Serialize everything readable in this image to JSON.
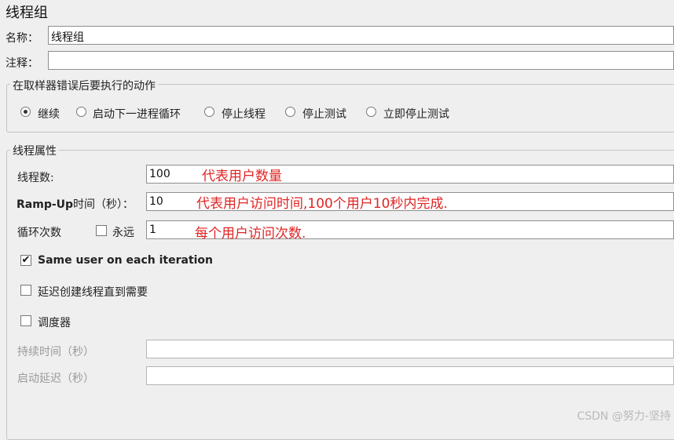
{
  "header": {
    "title": "线程组"
  },
  "name_field": {
    "label": "名称：",
    "value": "线程组"
  },
  "comment_field": {
    "label": "注释：",
    "value": ""
  },
  "error_action": {
    "legend": "在取样器错误后要执行的动作",
    "options": [
      {
        "label": "继续",
        "selected": true
      },
      {
        "label": "启动下一进程循环",
        "selected": false
      },
      {
        "label": "停止线程",
        "selected": false
      },
      {
        "label": "停止测试",
        "selected": false
      },
      {
        "label": "立即停止测试",
        "selected": false
      }
    ]
  },
  "thread_props": {
    "legend": "线程属性",
    "num_threads": {
      "label": "线程数:",
      "value": "100",
      "annotation": "代表用户数量"
    },
    "ramp_up": {
      "label_bold": "Ramp-Up",
      "label_rest": "时间（秒）：",
      "value": "10",
      "annotation": "代表用户访问时间,100个用户10秒内完成."
    },
    "loop": {
      "label": "循环次数",
      "forever_label": "永远",
      "forever_checked": false,
      "value": "1",
      "annotation": "每个用户访问次数."
    },
    "same_user": {
      "label": "Same user on each iteration",
      "checked": true
    },
    "delay_create": {
      "label": "延迟创建线程直到需要",
      "checked": false
    },
    "scheduler": {
      "label": "调度器",
      "checked": false
    },
    "duration": {
      "label": "持续时间（秒）",
      "value": ""
    },
    "startup_delay": {
      "label": "启动延迟（秒）",
      "value": ""
    }
  },
  "watermark": "CSDN @努力-坚持"
}
